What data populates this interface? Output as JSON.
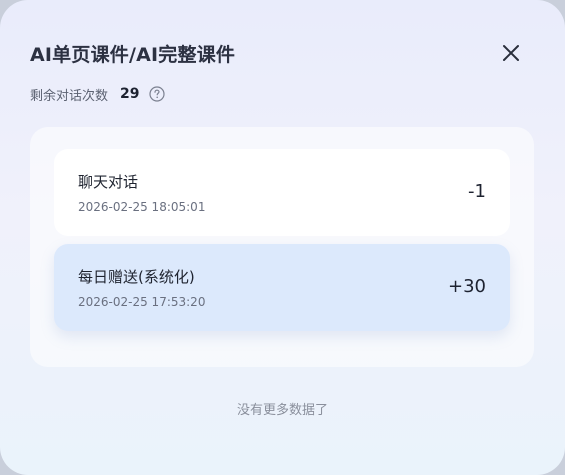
{
  "dialog": {
    "title": "AI单页课件/AI完整课件",
    "remaining_label": "剩余对话次数",
    "remaining_count": "29"
  },
  "records": [
    {
      "name": "聊天对话",
      "time": "2026-02-25 18:05:01",
      "delta": "-1"
    },
    {
      "name": "每日赠送(系统化)",
      "time": "2026-02-25 17:53:20",
      "delta": "+30"
    }
  ],
  "footer": {
    "no_more": "没有更多数据了"
  },
  "icons": {
    "close": "close-icon",
    "help": "help-circle-icon"
  },
  "colors": {
    "highlight_record": "#dce9fc",
    "title_text": "#2c3142"
  }
}
